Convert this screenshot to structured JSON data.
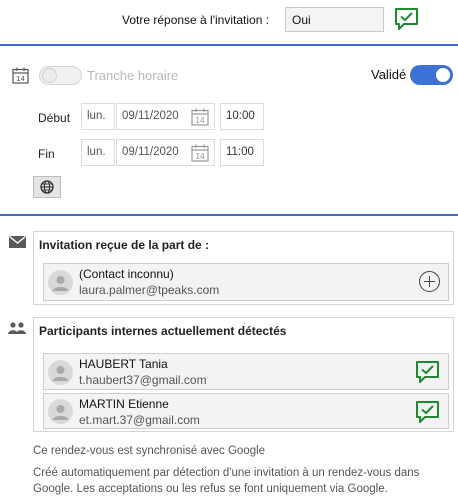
{
  "response": {
    "label": "Votre réponse à l'invitation :",
    "value": "Oui"
  },
  "schedule": {
    "slot_label": "Tranche horaire",
    "slot_enabled": false,
    "validated_label": "Validé",
    "validated_enabled": true,
    "start": {
      "label": "Début",
      "day": "lun.",
      "date": "09/11/2020",
      "time": "10:00"
    },
    "end": {
      "label": "Fin",
      "day": "lun.",
      "date": "09/11/2020",
      "time": "11:00"
    }
  },
  "invitation": {
    "title": "Invitation reçue de la part de :",
    "contact": {
      "name": "(Contact inconnu)",
      "email": "laura.palmer@tpeaks.com"
    }
  },
  "participants": {
    "title": "Participants internes actuellement détectés",
    "items": [
      {
        "name": "HAUBERT Tania",
        "email": "t.haubert37@gmail.com"
      },
      {
        "name": "MARTIN Etienne",
        "email": "et.mart.37@gmail.com"
      }
    ]
  },
  "footer": {
    "sync_note": "Ce rendez-vous est synchronisé avec Google",
    "auto_line1": "Créé automatiquement par détection d'une invitation à un rendez-vous dans",
    "auto_line2": "Google. Les acceptations ou les refus se font uniquement via Google."
  },
  "colors": {
    "accent_blue": "#3b72d4",
    "accept_green": "#1e8a2e"
  },
  "icons": [
    "accepted-check-icon",
    "calendar-icon",
    "globe-icon",
    "mail-icon",
    "people-icon",
    "add-contact-icon",
    "avatar-icon"
  ]
}
